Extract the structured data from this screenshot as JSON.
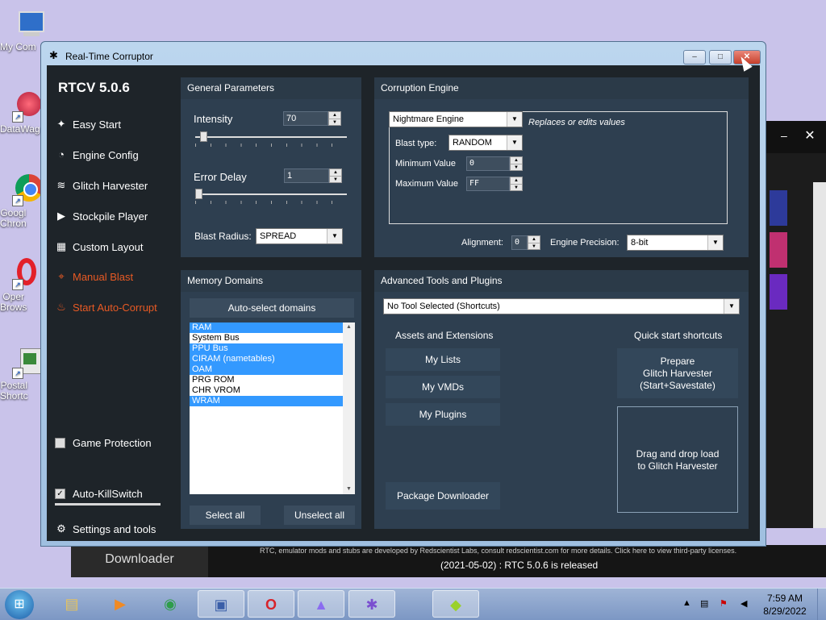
{
  "desktop": {
    "icons": [
      {
        "label": "My Com",
        "icon": "computer-icon"
      },
      {
        "label": "DataWag",
        "icon": "datawag-icon"
      },
      {
        "label": "Googl\nChron",
        "icon": "chrome-icon"
      },
      {
        "label": "Oper\nBrows",
        "icon": "opera-icon"
      },
      {
        "label": "Postal\nShortc",
        "icon": "postal-icon"
      }
    ]
  },
  "window": {
    "title": "Real-Time Corruptor",
    "controls": {
      "minimize": "–",
      "maximize": "□",
      "close": "✕"
    }
  },
  "sidebar": {
    "brand": "RTCV 5.0.6",
    "items": [
      {
        "label": "Easy Start",
        "icon": "wand-icon",
        "glyph": "✦"
      },
      {
        "label": "Engine Config",
        "icon": "gauge-icon",
        "glyph": "◔"
      },
      {
        "label": "Glitch Harvester",
        "icon": "layers-icon",
        "glyph": "≋"
      },
      {
        "label": "Stockpile Player",
        "icon": "play-icon",
        "glyph": "▶"
      },
      {
        "label": "Custom Layout",
        "icon": "grid-icon",
        "glyph": "▦"
      },
      {
        "label": "Manual Blast",
        "icon": "crosshair-icon",
        "glyph": "⌖"
      },
      {
        "label": "Start Auto-Corrupt",
        "icon": "fire-icon",
        "glyph": "♨"
      }
    ],
    "game_protection": {
      "label": "Game Protection",
      "checked": false
    },
    "auto_killswitch": {
      "label": "Auto-KillSwitch",
      "checked": true
    },
    "settings": {
      "label": "Settings and tools",
      "glyph": "⚙"
    }
  },
  "general": {
    "title": "General Parameters",
    "intensity_label": "Intensity",
    "intensity_value": "70",
    "error_delay_label": "Error Delay",
    "error_delay_value": "1",
    "blast_radius_label": "Blast Radius:",
    "blast_radius_value": "SPREAD"
  },
  "engine": {
    "title": "Corruption Engine",
    "selected": "Nightmare Engine",
    "hint": "Replaces or edits values",
    "blast_type_label": "Blast type:",
    "blast_type_value": "RANDOM",
    "min_label": "Minimum Value",
    "min_value": "0",
    "max_label": "Maximum Value",
    "max_value": "FF",
    "alignment_label": "Alignment:",
    "alignment_value": "0",
    "precision_label": "Engine Precision:",
    "precision_value": "8-bit"
  },
  "memory": {
    "title": "Memory Domains",
    "auto_select": "Auto-select domains",
    "domains": [
      {
        "name": "RAM",
        "selected": true
      },
      {
        "name": "System Bus",
        "selected": false
      },
      {
        "name": "PPU Bus",
        "selected": true
      },
      {
        "name": "CIRAM (nametables)",
        "selected": true
      },
      {
        "name": "OAM",
        "selected": true
      },
      {
        "name": "PRG ROM",
        "selected": false
      },
      {
        "name": "CHR VROM",
        "selected": false
      },
      {
        "name": "WRAM",
        "selected": true
      }
    ],
    "select_all": "Select all",
    "unselect_all": "Unselect all"
  },
  "advanced": {
    "title": "Advanced Tools and Plugins",
    "tool_select": "No Tool Selected (Shortcuts)",
    "assets_title": "Assets and Extensions",
    "my_lists": "My Lists",
    "my_vmds": "My VMDs",
    "my_plugins": "My Plugins",
    "package_downloader": "Package Downloader",
    "quick_title": "Quick start shortcuts",
    "prepare": "Prepare\nGlitch Harvester\n(Start+Savestate)",
    "drop_zone": "Drag and drop load\nto Glitch Harvester"
  },
  "background_app": {
    "downloader": "Downloader",
    "info": "RTC, emulator mods and stubs are developed by Redscientist Labs, consult redscientist.com for more details. Click here to view third-party licenses.",
    "release": "(2021-05-02) : RTC 5.0.6 is released"
  },
  "taskbar": {
    "apps": [
      {
        "name": "explorer",
        "glyph": "▤",
        "color": "#e8c35a"
      },
      {
        "name": "media-player",
        "glyph": "▶",
        "color": "#f08a24"
      },
      {
        "name": "chrome",
        "glyph": "◉",
        "color": "#2e9d4a"
      },
      {
        "name": "network",
        "glyph": "▣",
        "color": "#3a5ea8"
      },
      {
        "name": "opera",
        "glyph": "O",
        "color": "#d8232a"
      },
      {
        "name": "launcher",
        "glyph": "▲",
        "color": "#8a6cf0"
      },
      {
        "name": "rtc",
        "glyph": "✱",
        "color": "#7a4fd0"
      },
      {
        "name": "emulator",
        "glyph": "◆",
        "color": "#9ad12c"
      }
    ],
    "time": "7:59 AM",
    "date": "8/29/2022"
  }
}
